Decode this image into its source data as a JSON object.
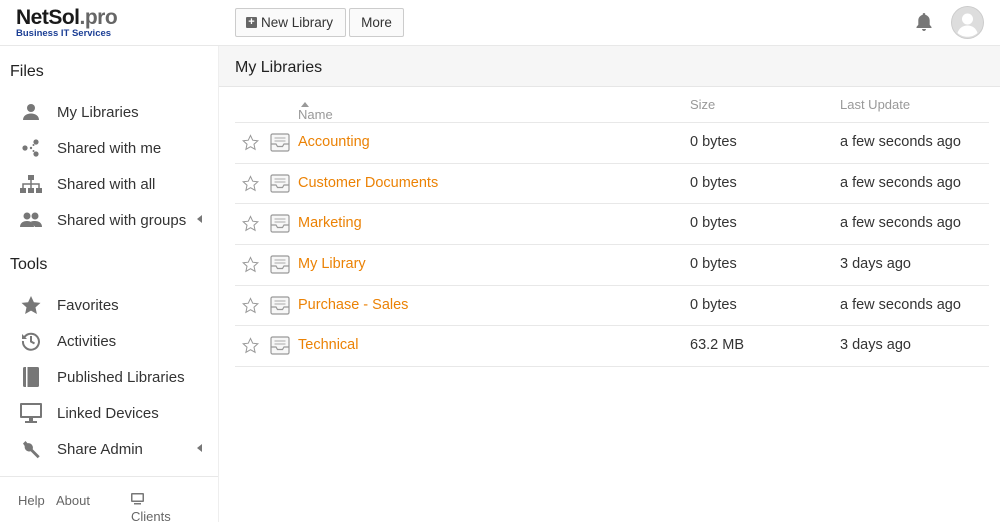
{
  "logo": {
    "main": "NetSol",
    "suffix": ".pro",
    "tagline": "Business IT Services"
  },
  "header": {
    "new_library_label": "New Library",
    "more_label": "More"
  },
  "sidebar": {
    "files_heading": "Files",
    "files_items": [
      {
        "label": "My Libraries",
        "icon": "user-icon"
      },
      {
        "label": "Shared with me",
        "icon": "share-icon"
      },
      {
        "label": "Shared with all",
        "icon": "org-chart-icon"
      },
      {
        "label": "Shared with groups",
        "icon": "group-icon"
      }
    ],
    "tools_heading": "Tools",
    "tools_items": [
      {
        "label": "Favorites",
        "icon": "star-icon"
      },
      {
        "label": "Activities",
        "icon": "history-icon"
      },
      {
        "label": "Published Libraries",
        "icon": "book-icon"
      },
      {
        "label": "Linked Devices",
        "icon": "monitor-icon"
      },
      {
        "label": "Share Admin",
        "icon": "wrench-icon"
      }
    ],
    "footer": {
      "help": "Help",
      "about": "About",
      "clients": "Clients"
    }
  },
  "main": {
    "title": "My Libraries",
    "columns": {
      "name": "Name",
      "size": "Size",
      "last_update": "Last Update"
    },
    "rows": [
      {
        "name": "Accounting",
        "size": "0 bytes",
        "updated": "a few seconds ago"
      },
      {
        "name": "Customer Documents",
        "size": "0 bytes",
        "updated": "a few seconds ago"
      },
      {
        "name": "Marketing",
        "size": "0 bytes",
        "updated": "a few seconds ago"
      },
      {
        "name": "My Library",
        "size": "0 bytes",
        "updated": "3 days ago"
      },
      {
        "name": "Purchase - Sales",
        "size": "0 bytes",
        "updated": "a few seconds ago"
      },
      {
        "name": "Technical",
        "size": "63.2 MB",
        "updated": "3 days ago"
      }
    ]
  },
  "colors": {
    "link": "#eb8205",
    "brand_blue": "#1c3f95"
  }
}
